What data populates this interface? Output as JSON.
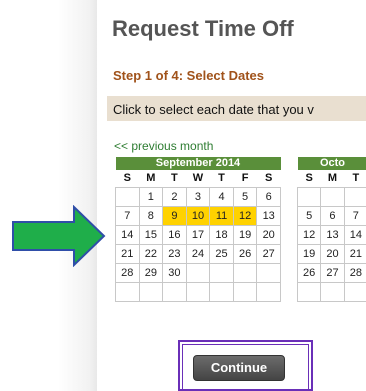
{
  "page": {
    "title": "Request Time Off",
    "step": "Step 1 of 4: Select Dates",
    "instruction": "Click to select each date that you v",
    "prev_month": "<< previous month",
    "continue_label": "Continue"
  },
  "calendars": [
    {
      "month": "September 2014",
      "dow": [
        "S",
        "M",
        "T",
        "W",
        "T",
        "F",
        "S"
      ],
      "weeks": [
        [
          "",
          "1",
          "2",
          "3",
          "4",
          "5",
          "6"
        ],
        [
          "7",
          "8",
          "9",
          "10",
          "11",
          "12",
          "13"
        ],
        [
          "14",
          "15",
          "16",
          "17",
          "18",
          "19",
          "20"
        ],
        [
          "21",
          "22",
          "23",
          "24",
          "25",
          "26",
          "27"
        ],
        [
          "28",
          "29",
          "30",
          "",
          "",
          "",
          ""
        ],
        [
          "",
          "",
          "",
          "",
          "",
          "",
          ""
        ]
      ],
      "selected": [
        "9",
        "10",
        "11",
        "12"
      ]
    },
    {
      "month": "Octo",
      "dow": [
        "S",
        "M",
        "T"
      ],
      "weeks": [
        [
          "",
          "",
          ""
        ],
        [
          "5",
          "6",
          "7"
        ],
        [
          "12",
          "13",
          "14"
        ],
        [
          "19",
          "20",
          "21"
        ],
        [
          "26",
          "27",
          "28"
        ],
        [
          "",
          "",
          ""
        ]
      ],
      "selected": []
    }
  ],
  "colors": {
    "arrow_fill": "#1fae4a",
    "arrow_outline": "#2f4ea8",
    "highlight_frame": "#6a2fb8",
    "selected_day": "#ffd200",
    "month_header": "#5a8f3a",
    "step_text": "#a0521a"
  }
}
